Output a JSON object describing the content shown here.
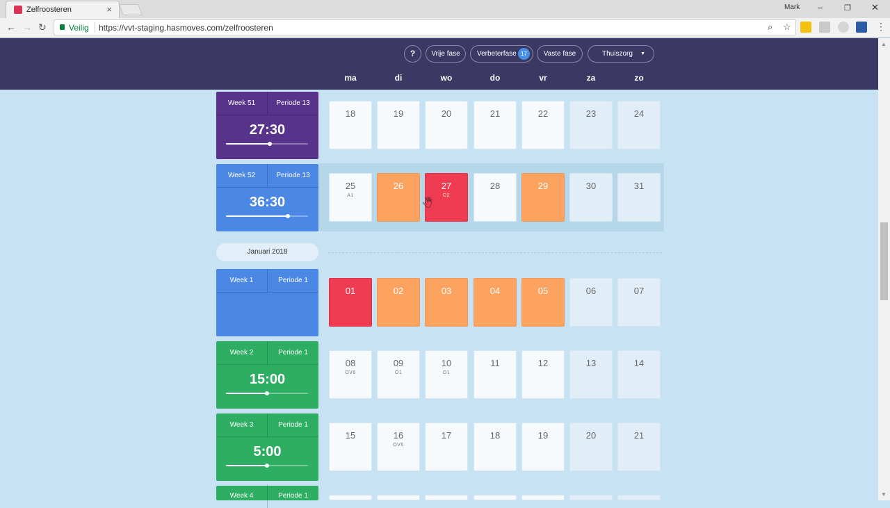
{
  "browser": {
    "tab_title": "Zelfroosteren",
    "profile_name": "Mark",
    "secure_label": "Veilig",
    "url": "https://vvt-staging.hasmoves.com/zelfroosteren"
  },
  "header": {
    "help_label": "?",
    "phases": [
      {
        "label": "Vrije fase"
      },
      {
        "label": "Verbeterfase",
        "badge": "17"
      },
      {
        "label": "Vaste fase"
      }
    ],
    "org_select": "Thuiszorg",
    "days": [
      "ma",
      "di",
      "wo",
      "do",
      "vr",
      "za",
      "zo"
    ]
  },
  "weeks": [
    {
      "week": "Week 51",
      "period": "Periode 13",
      "hours": "27:30",
      "color": "#57338c",
      "progress": 0.53,
      "days": [
        {
          "num": "18",
          "code": ""
        },
        {
          "num": "19",
          "code": ""
        },
        {
          "num": "20",
          "code": ""
        },
        {
          "num": "21",
          "code": ""
        },
        {
          "num": "22",
          "code": ""
        },
        {
          "num": "23",
          "code": ""
        },
        {
          "num": "24",
          "code": ""
        }
      ]
    },
    {
      "week": "Week 52",
      "period": "Periode 13",
      "hours": "36:30",
      "color": "#4b87e5",
      "progress": 0.75,
      "days": [
        {
          "num": "25",
          "code": "A1"
        },
        {
          "num": "26",
          "code": "",
          "status": "orange"
        },
        {
          "num": "27",
          "code": "O2",
          "status": "red"
        },
        {
          "num": "28",
          "code": ""
        },
        {
          "num": "29",
          "code": "",
          "status": "orange"
        },
        {
          "num": "30",
          "code": ""
        },
        {
          "num": "31",
          "code": ""
        }
      ]
    },
    {
      "week": "Week 1",
      "period": "Periode 1",
      "hours": "",
      "color": "#4b87e5",
      "days": [
        {
          "num": "01",
          "code": "",
          "status": "red"
        },
        {
          "num": "02",
          "code": "",
          "status": "orange"
        },
        {
          "num": "03",
          "code": "",
          "status": "orange"
        },
        {
          "num": "04",
          "code": "",
          "status": "orange"
        },
        {
          "num": "05",
          "code": "",
          "status": "orange"
        },
        {
          "num": "06",
          "code": ""
        },
        {
          "num": "07",
          "code": ""
        }
      ]
    },
    {
      "week": "Week 2",
      "period": "Periode 1",
      "hours": "15:00",
      "color": "#2eae62",
      "progress": 0.5,
      "days": [
        {
          "num": "08",
          "code": "OV6"
        },
        {
          "num": "09",
          "code": "O1"
        },
        {
          "num": "10",
          "code": "O1"
        },
        {
          "num": "11",
          "code": ""
        },
        {
          "num": "12",
          "code": ""
        },
        {
          "num": "13",
          "code": ""
        },
        {
          "num": "14",
          "code": ""
        }
      ]
    },
    {
      "week": "Week 3",
      "period": "Periode 1",
      "hours": "5:00",
      "color": "#2eae62",
      "progress": 0.5,
      "days": [
        {
          "num": "15",
          "code": ""
        },
        {
          "num": "16",
          "code": "OV6"
        },
        {
          "num": "17",
          "code": ""
        },
        {
          "num": "18",
          "code": ""
        },
        {
          "num": "19",
          "code": ""
        },
        {
          "num": "20",
          "code": ""
        },
        {
          "num": "21",
          "code": ""
        }
      ]
    },
    {
      "week": "Week 4",
      "period": "Periode 1",
      "hours": "",
      "color": "#2eae62",
      "days": [
        {
          "num": "",
          "code": ""
        },
        {
          "num": "",
          "code": ""
        },
        {
          "num": "",
          "code": ""
        },
        {
          "num": "",
          "code": ""
        },
        {
          "num": "",
          "code": ""
        },
        {
          "num": "",
          "code": ""
        },
        {
          "num": "",
          "code": ""
        }
      ]
    }
  ],
  "month_divider": "Januari 2018"
}
